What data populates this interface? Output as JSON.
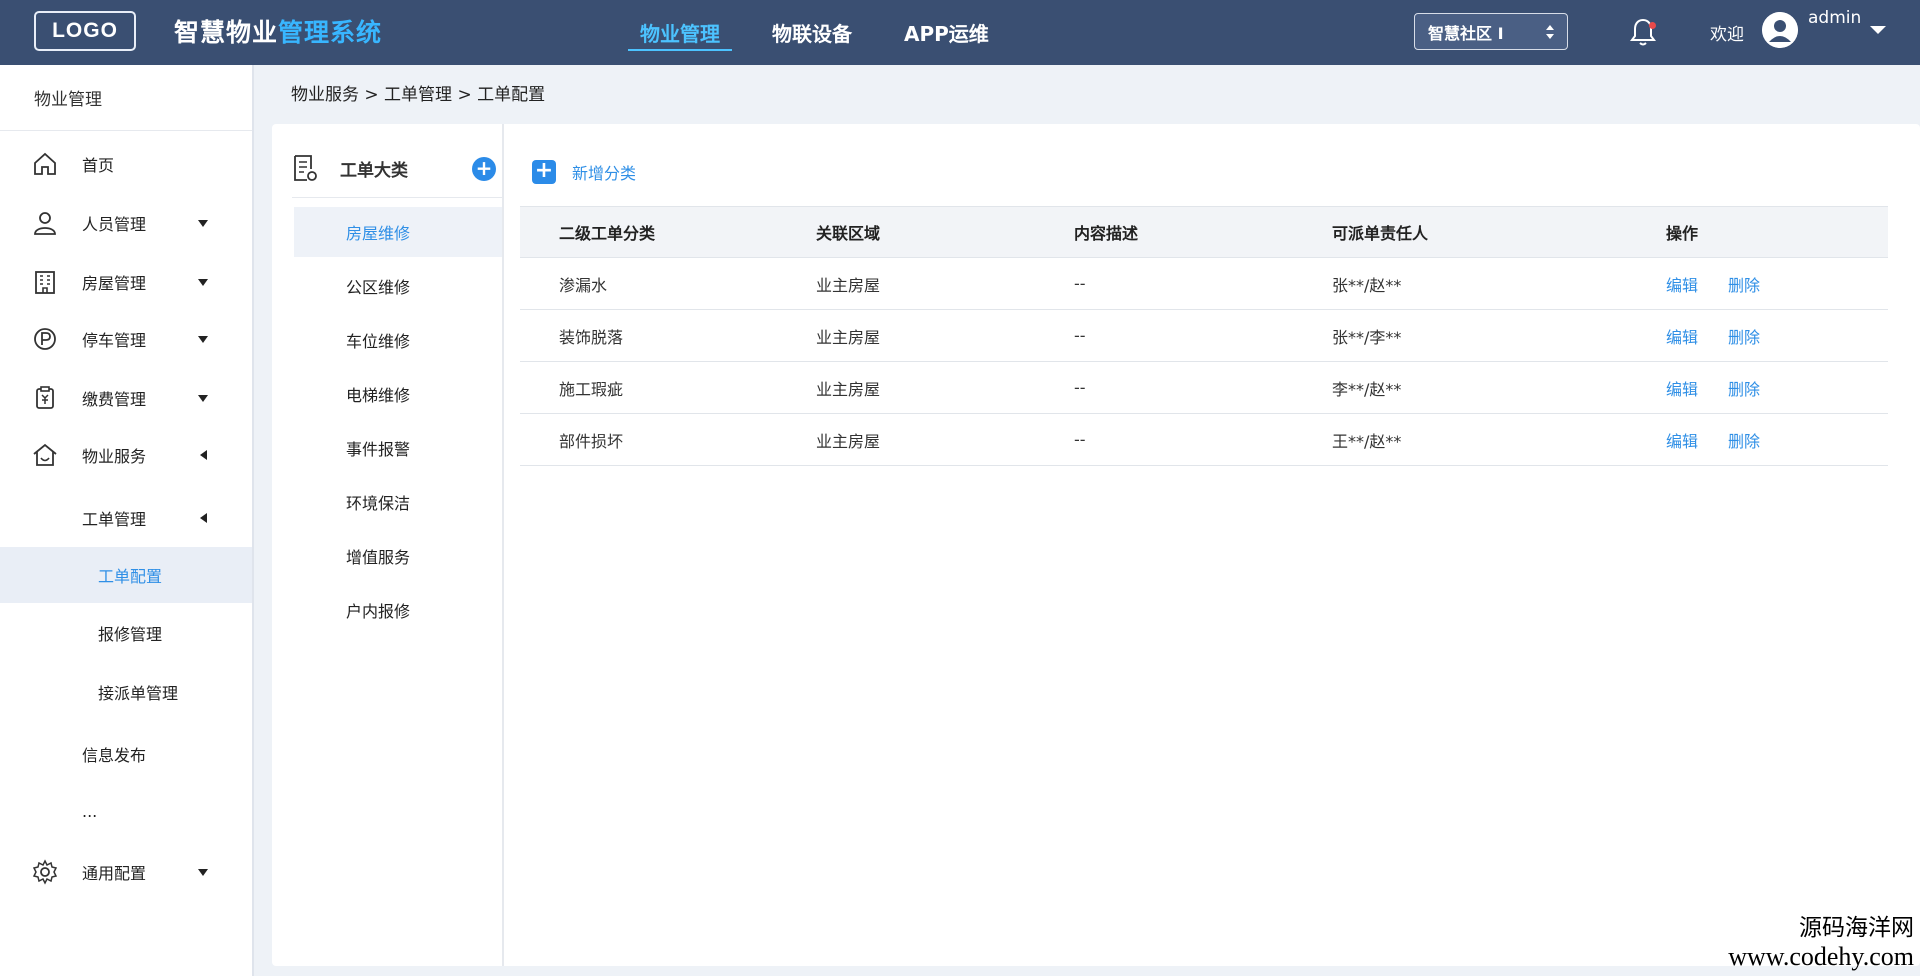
{
  "header": {
    "logo": "LOGO",
    "title_main": "智慧物业",
    "title_highlight": "管理系统",
    "nav": [
      "物业管理",
      "物联设备",
      "APP运维"
    ],
    "community_select": "智慧社区 I",
    "welcome": "欢迎",
    "username": "admin"
  },
  "sidebar": {
    "title": "物业管理",
    "items": [
      {
        "label": "首页",
        "icon": "home-icon"
      },
      {
        "label": "人员管理",
        "icon": "user-icon"
      },
      {
        "label": "房屋管理",
        "icon": "building-icon"
      },
      {
        "label": "停车管理",
        "icon": "parking-icon"
      },
      {
        "label": "缴费管理",
        "icon": "payment-icon"
      },
      {
        "label": "物业服务",
        "icon": "house-service-icon"
      },
      {
        "label": "工单管理"
      },
      {
        "label": "工单配置"
      },
      {
        "label": "报修管理"
      },
      {
        "label": "接派单管理"
      },
      {
        "label": "信息发布"
      },
      {
        "label": "..."
      },
      {
        "label": "通用配置",
        "icon": "gear-icon"
      }
    ]
  },
  "breadcrumb": "物业服务 > 工单管理 > 工单配置",
  "categories": {
    "title": "工单大类",
    "items": [
      "房屋维修",
      "公区维修",
      "车位维修",
      "电梯维修",
      "事件报警",
      "环境保洁",
      "增值服务",
      "户内报修"
    ]
  },
  "toolbar": {
    "add_label": "新增分类"
  },
  "table": {
    "columns": [
      "二级工单分类",
      "关联区域",
      "内容描述",
      "可派单责任人",
      "操作"
    ],
    "rows": [
      {
        "name": "渗漏水",
        "area": "业主房屋",
        "desc": "--",
        "person": "张**/赵**",
        "edit": "编辑",
        "delete": "删除"
      },
      {
        "name": "装饰脱落",
        "area": "业主房屋",
        "desc": "--",
        "person": "张**/李**",
        "edit": "编辑",
        "delete": "删除"
      },
      {
        "name": "施工瑕疵",
        "area": "业主房屋",
        "desc": "--",
        "person": "李**/赵**",
        "edit": "编辑",
        "delete": "删除"
      },
      {
        "name": "部件损坏",
        "area": "业主房屋",
        "desc": "--",
        "person": "王**/赵**",
        "edit": "编辑",
        "delete": "删除"
      }
    ]
  },
  "watermark": {
    "line1": "源码海洋网",
    "line2": "www.codehy.com"
  },
  "colors": {
    "topbar": "#3a4f72",
    "accent": "#2f8fe6",
    "nav_active": "#4cc3ff"
  }
}
